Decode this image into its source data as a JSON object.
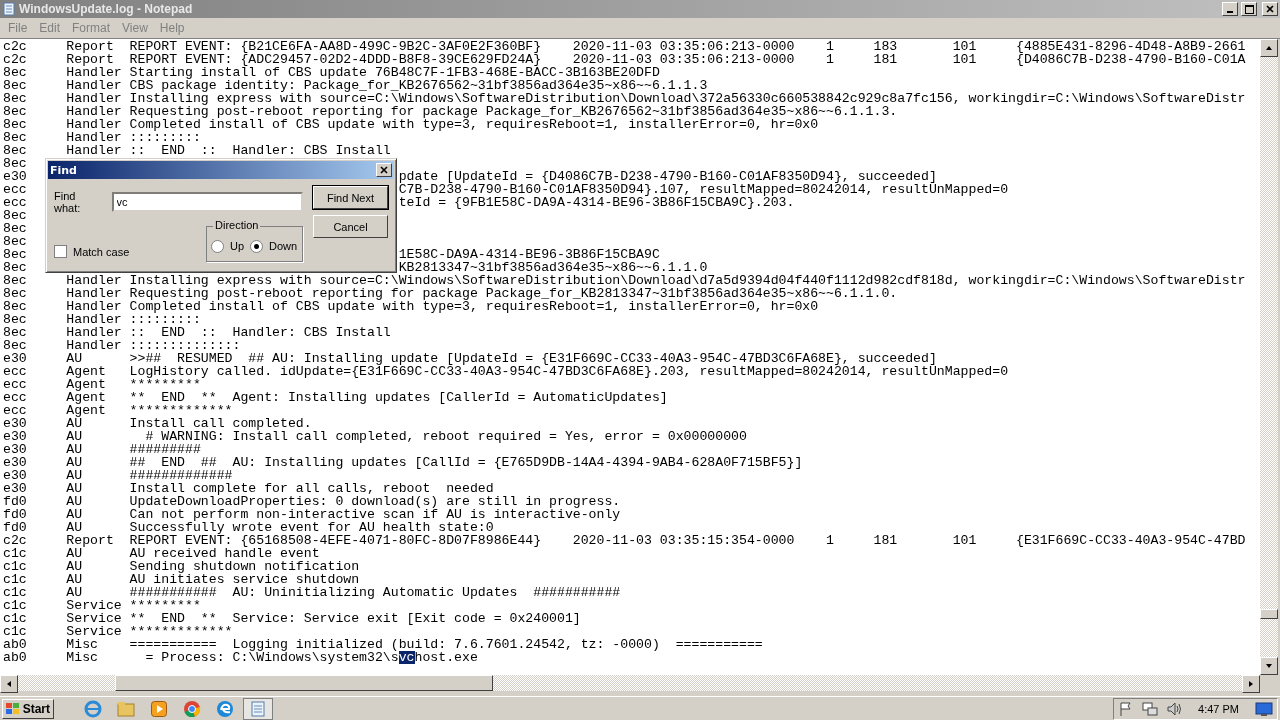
{
  "window": {
    "title": "WindowsUpdate.log - Notepad"
  },
  "menu": [
    "File",
    "Edit",
    "Format",
    "View",
    "Help"
  ],
  "lines": [
    {
      "kind": "full",
      "text": "c2c     Report  REPORT EVENT: {B21CE6FA-AA8D-499C-9B2C-3AF0E2F360BF}    2020-11-03 03:35:06:213-0000    1     183       101     {4885E431-8296-4D48-A8B9-2661"
    },
    {
      "kind": "full",
      "text": "c2c     Report  REPORT EVENT: {ADC29457-02D2-4DDD-B8F8-39CE629FD24A}    2020-11-03 03:35:06:213-0000    1     181       101     {D4086C7B-D238-4790-B160-C01A"
    },
    {
      "kind": "full",
      "text": "8ec     Handler Starting install of CBS update 76B48C7F-1FB3-468E-BACC-3B163BE20DFD"
    },
    {
      "kind": "full",
      "text": "8ec     Handler CBS package identity: Package_for_KB2676562~31bf3856ad364e35~x86~~6.1.1.3"
    },
    {
      "kind": "full",
      "text": "8ec     Handler Installing express with source=C:\\Windows\\SoftwareDistribution\\Download\\372a56330c660538842c929c8a7fc156, workingdir=C:\\Windows\\SoftwareDistr"
    },
    {
      "kind": "full",
      "text": "8ec     Handler Requesting post-reboot reporting for package Package_for_KB2676562~31bf3856ad364e35~x86~~6.1.1.3."
    },
    {
      "kind": "full",
      "text": "8ec     Handler Completed install of CBS update with type=3, requiresReboot=1, installerError=0, hr=0x0"
    },
    {
      "kind": "full",
      "text": "8ec     Handler :::::::::"
    },
    {
      "kind": "full",
      "text": "8ec     Handler ::  END  ::  Handler: CBS Install"
    },
    {
      "kind": "covered",
      "thread": "8ec"
    },
    {
      "kind": "covered",
      "thread": "e30",
      "tail": "pdate [UpdateId = {D4086C7B-D238-4790-B160-C01AF8350D94}, succeeded]"
    },
    {
      "kind": "covered",
      "thread": "ecc",
      "tail": "C7B-D238-4790-B160-C01AF8350D94}.107, resultMapped=80242014, resultUnMapped=0"
    },
    {
      "kind": "covered",
      "thread": "ecc",
      "tail": "teId = {9FB1E58C-DA9A-4314-BE96-3B86F15CBA9C}.203."
    },
    {
      "kind": "covered",
      "thread": "8ec"
    },
    {
      "kind": "covered",
      "thread": "8ec"
    },
    {
      "kind": "covered",
      "thread": "8ec"
    },
    {
      "kind": "covered",
      "thread": "8ec",
      "tail": "1E58C-DA9A-4314-BE96-3B86F15CBA9C"
    },
    {
      "kind": "covered",
      "thread": "8ec",
      "tail": "KB2813347~31bf3856ad364e35~x86~~6.1.1.0"
    },
    {
      "kind": "full",
      "text": "8ec     Handler Installing express with source=C:\\Windows\\SoftwareDistribution\\Download\\d7a5d9394d04f440f1112d982cdf818d, workingdir=C:\\Windows\\SoftwareDistr"
    },
    {
      "kind": "full",
      "text": "8ec     Handler Requesting post-reboot reporting for package Package_for_KB2813347~31bf3856ad364e35~x86~~6.1.1.0."
    },
    {
      "kind": "full",
      "text": "8ec     Handler Completed install of CBS update with type=3, requiresReboot=1, installerError=0, hr=0x0"
    },
    {
      "kind": "full",
      "text": "8ec     Handler :::::::::"
    },
    {
      "kind": "full",
      "text": "8ec     Handler ::  END  ::  Handler: CBS Install"
    },
    {
      "kind": "full",
      "text": "8ec     Handler ::::::::::::::"
    },
    {
      "kind": "full",
      "text": "e30     AU      >>##  RESUMED  ## AU: Installing update [UpdateId = {E31F669C-CC33-40A3-954C-47BD3C6FA68E}, succeeded]"
    },
    {
      "kind": "full",
      "text": "ecc     Agent   LogHistory called. idUpdate={E31F669C-CC33-40A3-954C-47BD3C6FA68E}.203, resultMapped=80242014, resultUnMapped=0"
    },
    {
      "kind": "full",
      "text": "ecc     Agent   *********"
    },
    {
      "kind": "full",
      "text": "ecc     Agent   **  END  **  Agent: Installing updates [CallerId = AutomaticUpdates]"
    },
    {
      "kind": "full",
      "text": "ecc     Agent   *************"
    },
    {
      "kind": "full",
      "text": "e30     AU      Install call completed."
    },
    {
      "kind": "full",
      "text": "e30     AU        # WARNING: Install call completed, reboot required = Yes, error = 0x00000000"
    },
    {
      "kind": "full",
      "text": "e30     AU      #########"
    },
    {
      "kind": "full",
      "text": "e30     AU      ##  END  ##  AU: Installing updates [CallId = {E765D9DB-14A4-4394-9AB4-628A0F715BF5}]"
    },
    {
      "kind": "full",
      "text": "e30     AU      #############"
    },
    {
      "kind": "full",
      "text": "e30     AU      Install complete for all calls, reboot  needed"
    },
    {
      "kind": "full",
      "text": "fd0     AU      UpdateDownloadProperties: 0 download(s) are still in progress."
    },
    {
      "kind": "full",
      "text": "fd0     AU      Can not perform non-interactive scan if AU is interactive-only"
    },
    {
      "kind": "full",
      "text": "fd0     AU      Successfully wrote event for AU health state:0"
    },
    {
      "kind": "full",
      "text": "c2c     Report  REPORT EVENT: {65168508-4EFE-4071-80FC-8D07F8986E44}    2020-11-03 03:35:15:354-0000    1     181       101     {E31F669C-CC33-40A3-954C-47BD"
    },
    {
      "kind": "full",
      "text": "c1c     AU      AU received handle event"
    },
    {
      "kind": "full",
      "text": "c1c     AU      Sending shutdown notification"
    },
    {
      "kind": "full",
      "text": "c1c     AU      AU initiates service shutdown"
    },
    {
      "kind": "full",
      "text": "c1c     AU      ###########  AU: Uninitializing Automatic Updates  ###########"
    },
    {
      "kind": "full",
      "text": "c1c     Service *********"
    },
    {
      "kind": "full",
      "text": "c1c     Service **  END  **  Service: Service exit [Exit code = 0x240001]"
    },
    {
      "kind": "full",
      "text": "c1c     Service *************"
    },
    {
      "kind": "full",
      "text": "ab0     Misc    ===========  Logging initialized (build: 7.6.7601.24542, tz: -0000)  ==========="
    },
    {
      "kind": "selection",
      "before": "ab0     Misc      = Process: C:\\Windows\\system32\\s",
      "selected": "vc",
      "after": "host.exe"
    }
  ],
  "find_dialog": {
    "title": "Find",
    "find_what_label": "Find what:",
    "find_what_value": "vc",
    "buttons": [
      {
        "label": "Find Next",
        "default": true
      },
      {
        "label": "Cancel",
        "default": false
      }
    ],
    "direction": {
      "label": "Direction",
      "options": [
        {
          "label": "Up",
          "selected": false
        },
        {
          "label": "Down",
          "selected": true
        }
      ]
    },
    "match_case": {
      "label": "Match case",
      "checked": false
    }
  },
  "taskbar": {
    "start": "Start",
    "apps": [
      {
        "kind": "ie",
        "selected": false
      },
      {
        "kind": "explorer",
        "selected": false
      },
      {
        "kind": "media",
        "selected": false
      },
      {
        "kind": "chrome",
        "selected": false
      },
      {
        "kind": "edge",
        "selected": false
      },
      {
        "kind": "notepad",
        "selected": true
      }
    ],
    "clock": "4:47 PM"
  }
}
